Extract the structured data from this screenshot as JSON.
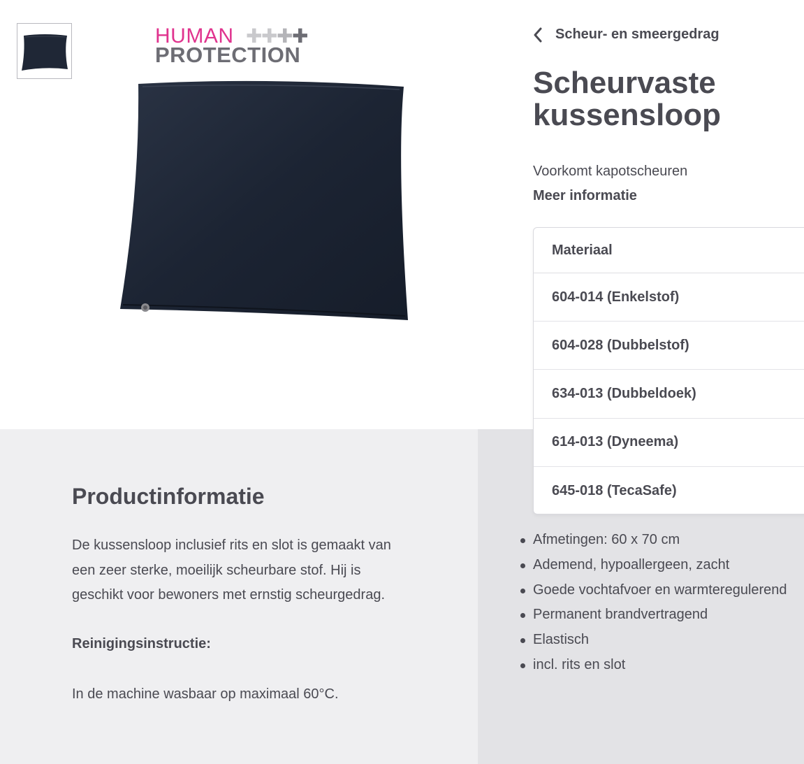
{
  "brand": {
    "logo_line1": "HUMAN",
    "logo_line2": "PROTECTION",
    "accent_color": "#e0338e",
    "text_color": "#4a4a52"
  },
  "gallery": {
    "thumbnail_icon": "pillow-thumbnail",
    "main_image_icon": "pillow-image"
  },
  "header": {
    "back_label": "Scheur- en smeergedrag",
    "title": "Scheurvaste kussensloop",
    "subtitle": "Voorkomt kapotscheuren",
    "more_info": "Meer informatie"
  },
  "material_dropdown": {
    "label": "Materiaal",
    "options": [
      "604-014 (Enkelstof)",
      "604-028 (Dubbelstof)",
      "634-013 (Dubbeldoek)",
      "614-013 (Dyneema)",
      "645-018 (TecaSafe)"
    ]
  },
  "product_info": {
    "title": "Productinformatie",
    "description": "De kussensloop inclusief rits en slot is gemaakt van een zeer sterke, moeilijk scheurbare stof. Hij is geschikt voor bewoners met ernstig scheurgedrag.",
    "cleaning_title": "Reinigingsinstructie:",
    "cleaning_text": "In de machine wasbaar op maximaal 60°C."
  },
  "features": [
    "Afmetingen: 60 x 70 cm",
    "Ademend, hypoallergeen, zacht",
    "Goede vochtafvoer en warmteregulerend",
    "Permanent brandvertragend",
    "Elastisch",
    "incl. rits en slot"
  ]
}
